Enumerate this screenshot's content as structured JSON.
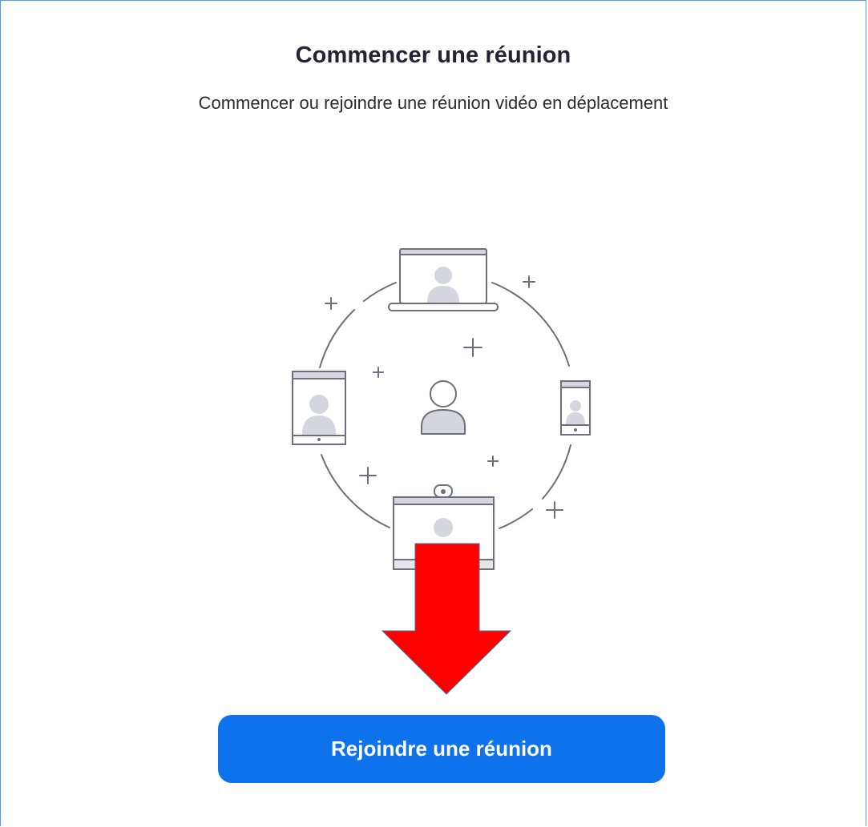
{
  "screen": {
    "title": "Commencer une réunion",
    "subtitle": "Commencer ou rejoindre une réunion vidéo en déplacement"
  },
  "illustration": {
    "icons": [
      "laptop-icon",
      "tablet-icon",
      "phone-icon",
      "room-display-icon",
      "user-icon",
      "plus-icon"
    ],
    "annotation_arrow_color": "#ff0000"
  },
  "actions": {
    "join_button_label": "Rejoindre une réunion",
    "join_button_color": "#0e72ed"
  }
}
